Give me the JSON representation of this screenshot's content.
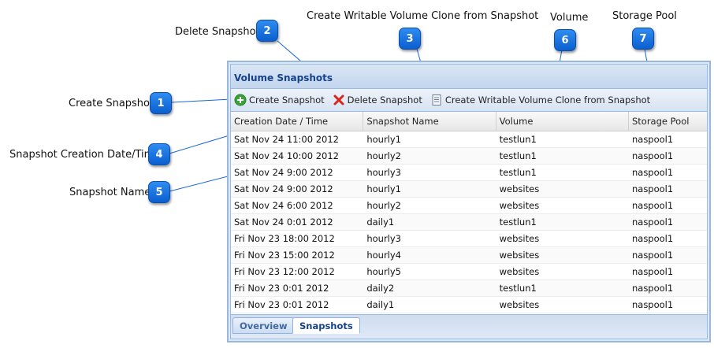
{
  "callouts": [
    {
      "number": "1",
      "label": "Create Snapshot"
    },
    {
      "number": "2",
      "label": "Delete Snapshot"
    },
    {
      "number": "3",
      "label": "Create Writable Volume Clone from Snapshot"
    },
    {
      "number": "4",
      "label": "Snapshot Creation Date/Time"
    },
    {
      "number": "5",
      "label": "Snapshot Name"
    },
    {
      "number": "6",
      "label": "Volume"
    },
    {
      "number": "7",
      "label": "Storage Pool"
    }
  ],
  "panel": {
    "title": "Volume Snapshots"
  },
  "toolbar": {
    "create_label": "Create Snapshot",
    "delete_label": "Delete Snapshot",
    "clone_label": "Create Writable Volume Clone from Snapshot"
  },
  "grid": {
    "columns": [
      "Creation Date / Time",
      "Snapshot Name",
      "Volume",
      "Storage Pool"
    ],
    "rows": [
      [
        "Sat Nov 24 11:00 2012",
        "hourly1",
        "testlun1",
        "naspool1"
      ],
      [
        "Sat Nov 24 10:00 2012",
        "hourly2",
        "testlun1",
        "naspool1"
      ],
      [
        "Sat Nov 24 9:00 2012",
        "hourly3",
        "testlun1",
        "naspool1"
      ],
      [
        "Sat Nov 24 9:00 2012",
        "hourly1",
        "websites",
        "naspool1"
      ],
      [
        "Sat Nov 24 6:00 2012",
        "hourly2",
        "websites",
        "naspool1"
      ],
      [
        "Sat Nov 24 0:01 2012",
        "daily1",
        "testlun1",
        "naspool1"
      ],
      [
        "Fri Nov 23 18:00 2012",
        "hourly3",
        "websites",
        "naspool1"
      ],
      [
        "Fri Nov 23 15:00 2012",
        "hourly4",
        "websites",
        "naspool1"
      ],
      [
        "Fri Nov 23 12:00 2012",
        "hourly5",
        "websites",
        "naspool1"
      ],
      [
        "Fri Nov 23 0:01 2012",
        "daily2",
        "testlun1",
        "naspool1"
      ],
      [
        "Fri Nov 23 0:01 2012",
        "daily1",
        "websites",
        "naspool1"
      ]
    ]
  },
  "tabs": [
    {
      "label": "Overview",
      "active": false
    },
    {
      "label": "Snapshots",
      "active": true
    }
  ],
  "icons": {
    "create": "add-circle-icon",
    "delete": "red-x-icon",
    "clone": "document-icon"
  },
  "colors": {
    "badge": "#1a73e0",
    "panel_title": "#15428b",
    "create_green": "#3aa33a",
    "delete_red": "#d9261c"
  }
}
